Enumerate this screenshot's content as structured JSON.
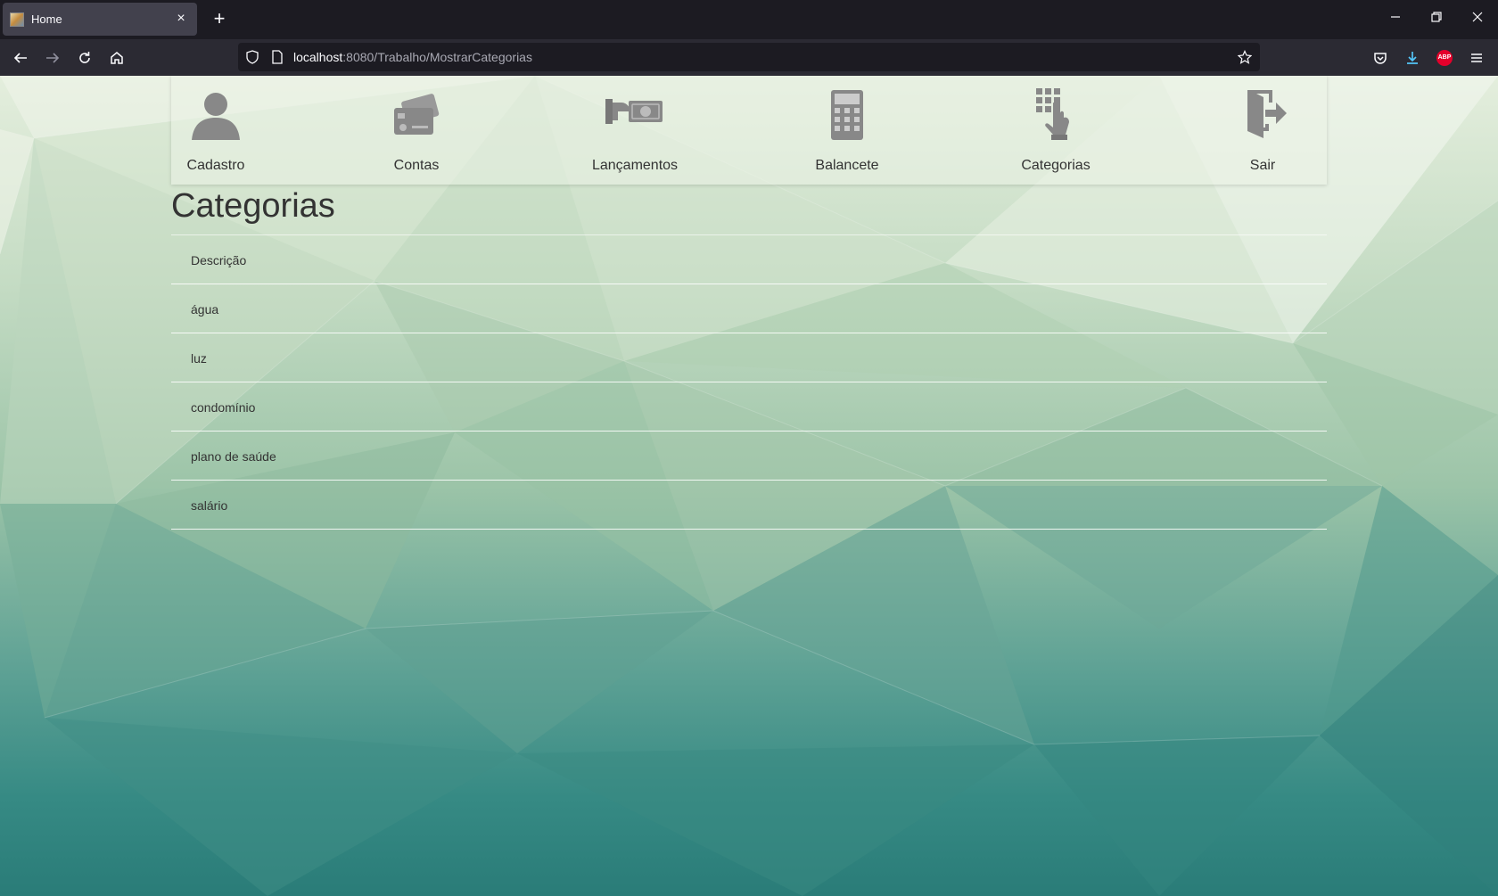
{
  "browser": {
    "tab_title": "Home",
    "tab_close": "×",
    "new_tab": "+",
    "url_host": "localhost",
    "url_path": ":8080/Trabalho/MostrarCategorias",
    "abp_label": "ABP"
  },
  "menu": {
    "items": [
      {
        "label": "Cadastro",
        "icon": "user-icon"
      },
      {
        "label": "Contas",
        "icon": "credit-card-icon"
      },
      {
        "label": "Lançamentos",
        "icon": "hand-money-icon"
      },
      {
        "label": "Balancete",
        "icon": "calculator-icon"
      },
      {
        "label": "Categorias",
        "icon": "keypad-touch-icon"
      },
      {
        "label": "Sair",
        "icon": "logout-door-icon"
      }
    ]
  },
  "page": {
    "title": "Categorias",
    "table_header": "Descrição",
    "rows": [
      "água",
      "luz",
      "condomínio",
      "plano de saúde",
      "salário"
    ]
  }
}
